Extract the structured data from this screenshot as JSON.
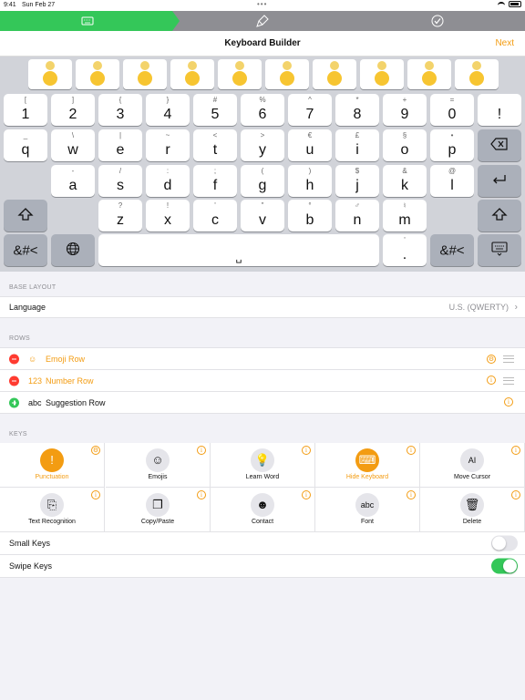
{
  "status_bar": {
    "time": "9:41",
    "date": "Sun Feb 27"
  },
  "progress": {
    "steps": [
      "keyboard-icon",
      "brush-icon",
      "checkmark-icon"
    ],
    "current_step": 1,
    "colors": {
      "done": "#34c759",
      "pending": "#8e8e93"
    }
  },
  "nav": {
    "title": "Keyboard Builder",
    "next_label": "Next"
  },
  "keyboard": {
    "emoji_row_count": 10,
    "number_row": [
      {
        "sub": "[",
        "main": "1"
      },
      {
        "sub": "]",
        "main": "2"
      },
      {
        "sub": "{",
        "main": "3"
      },
      {
        "sub": "}",
        "main": "4"
      },
      {
        "sub": "#",
        "main": "5"
      },
      {
        "sub": "%",
        "main": "6"
      },
      {
        "sub": "^",
        "main": "7"
      },
      {
        "sub": "*",
        "main": "8"
      },
      {
        "sub": "+",
        "main": "9"
      },
      {
        "sub": "=",
        "main": "0"
      },
      {
        "sub": "",
        "main": "!"
      }
    ],
    "row_q": [
      {
        "sub": "_",
        "main": "q"
      },
      {
        "sub": "\\",
        "main": "w"
      },
      {
        "sub": "|",
        "main": "e"
      },
      {
        "sub": "~",
        "main": "r"
      },
      {
        "sub": "<",
        "main": "t"
      },
      {
        "sub": ">",
        "main": "y"
      },
      {
        "sub": "€",
        "main": "u"
      },
      {
        "sub": "£",
        "main": "i"
      },
      {
        "sub": "§",
        "main": "o"
      },
      {
        "sub": "•",
        "main": "p"
      }
    ],
    "row_a": [
      {
        "sub": "-",
        "main": "a"
      },
      {
        "sub": "/",
        "main": "s"
      },
      {
        "sub": ":",
        "main": "d"
      },
      {
        "sub": ";",
        "main": "f"
      },
      {
        "sub": "(",
        "main": "g"
      },
      {
        "sub": ")",
        "main": "h"
      },
      {
        "sub": "$",
        "main": "j"
      },
      {
        "sub": "&",
        "main": "k"
      },
      {
        "sub": "@",
        "main": "l"
      }
    ],
    "row_z": [
      {
        "sub": "?",
        "main": "z"
      },
      {
        "sub": "!",
        "main": "x"
      },
      {
        "sub": "'",
        "main": "c"
      },
      {
        "sub": "\"",
        "main": "v"
      },
      {
        "sub": "°",
        "main": "b"
      },
      {
        "sub": "♂",
        "main": "n"
      },
      {
        "sub": "♮",
        "main": "m"
      }
    ],
    "symbols_label": "&#<",
    "period_key": {
      "sub": "'",
      "main": "."
    },
    "space_glyph": "␣",
    "icons": {
      "delete": "delete-backward-icon",
      "return": "return-icon",
      "shift": "shift-icon",
      "globe": "globe-icon",
      "hide": "keyboard-hide-icon"
    }
  },
  "base_layout": {
    "header": "BASE LAYOUT",
    "language_label": "Language",
    "language_value": "U.S. (QWERTY)"
  },
  "rows": {
    "header": "ROWS",
    "items": [
      {
        "icon": "☺",
        "label": "Emoji Row",
        "enabled": true
      },
      {
        "icon": "123",
        "label": "Number Row",
        "enabled": true
      },
      {
        "icon": "abc",
        "label": "Suggestion Row",
        "enabled": false
      }
    ]
  },
  "keys": {
    "header": "KEYS",
    "tiles": [
      {
        "label": "Punctuation",
        "icon": "!",
        "selected": true
      },
      {
        "label": "Emojis",
        "icon": "☺",
        "selected": false
      },
      {
        "label": "Learn Word",
        "icon": "💡",
        "selected": false
      },
      {
        "label": "Hide Keyboard",
        "icon": "⌨",
        "selected": true
      },
      {
        "label": "Move Cursor",
        "icon": "AI",
        "selected": false
      },
      {
        "label": "Text Recognition",
        "icon": "⎘",
        "selected": false
      },
      {
        "label": "Copy/Paste",
        "icon": "❐",
        "selected": false
      },
      {
        "label": "Contact",
        "icon": "☻",
        "selected": false
      },
      {
        "label": "Font",
        "icon": "abc",
        "selected": false
      },
      {
        "label": "Delete",
        "icon": "🗑",
        "selected": false
      }
    ]
  },
  "toggles": [
    {
      "label": "Small Keys",
      "on": false
    },
    {
      "label": "Swipe Keys",
      "on": true
    }
  ],
  "accent_color": "#f39c12"
}
